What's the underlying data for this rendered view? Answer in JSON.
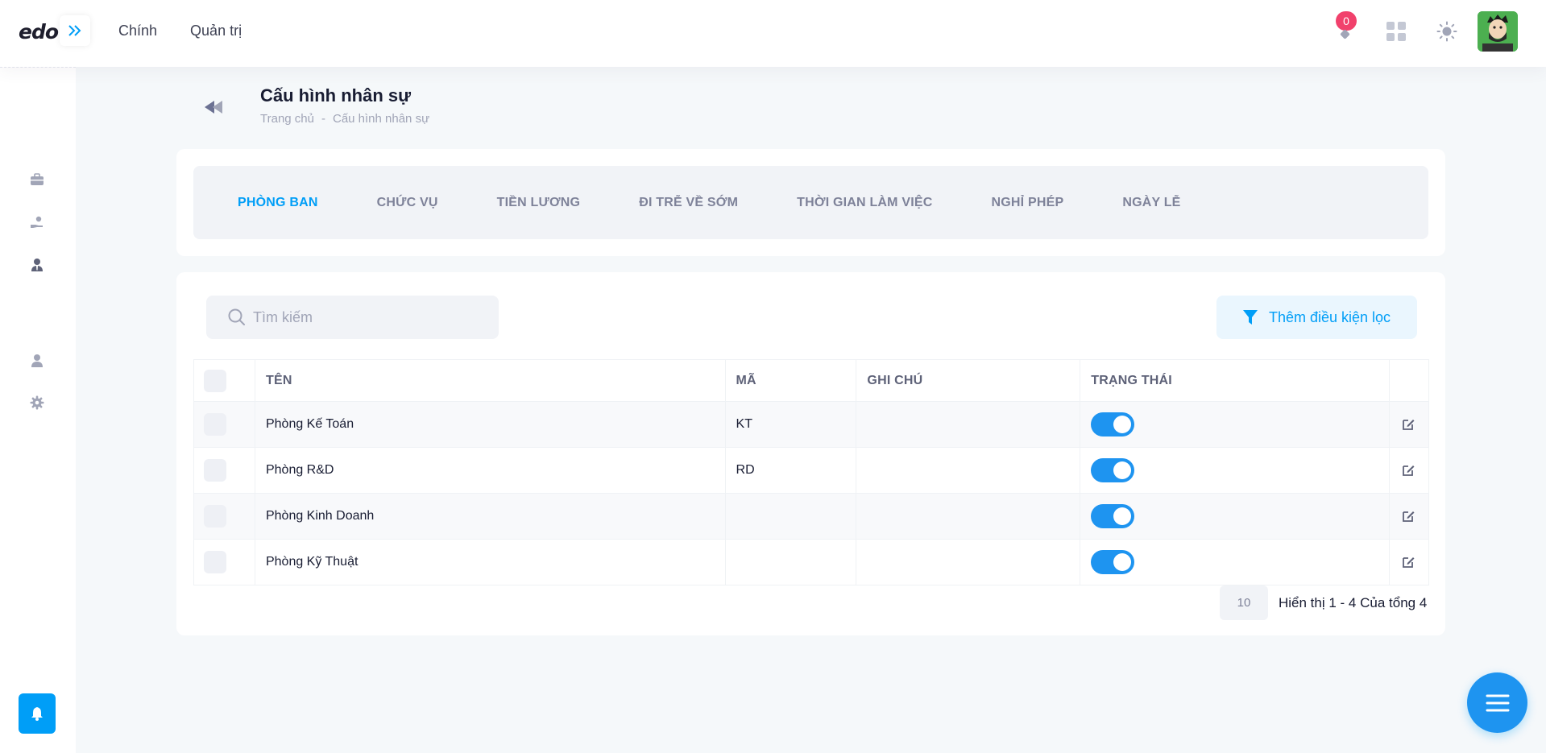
{
  "header": {
    "logo": "edo",
    "nav": [
      "Chính",
      "Quản trị"
    ],
    "notification_count": "0"
  },
  "page": {
    "title": "Cấu hình nhân sự",
    "breadcrumb": [
      "Trang chủ",
      "-",
      "Cấu hình nhân sự"
    ]
  },
  "tabs": [
    {
      "label": "PHÒNG BAN",
      "active": true
    },
    {
      "label": "CHỨC VỤ",
      "active": false
    },
    {
      "label": "TIỀN LƯƠNG",
      "active": false
    },
    {
      "label": "ĐI TRỄ VỀ SỚM",
      "active": false
    },
    {
      "label": "THỜI GIAN LÀM VIỆC",
      "active": false
    },
    {
      "label": "NGHỈ PHÉP",
      "active": false
    },
    {
      "label": "NGÀY LỄ",
      "active": false
    }
  ],
  "search": {
    "placeholder": "Tìm kiếm"
  },
  "filter_label": "Thêm điều kiện lọc",
  "table": {
    "columns": [
      "TÊN",
      "MÃ",
      "GHI CHÚ",
      "TRẠNG THÁI"
    ],
    "rows": [
      {
        "name": "Phòng Kế Toán",
        "code": "KT",
        "note": "",
        "status": true
      },
      {
        "name": "Phòng R&D",
        "code": "RD",
        "note": "",
        "status": true
      },
      {
        "name": "Phòng Kinh Doanh",
        "code": "",
        "note": "",
        "status": true
      },
      {
        "name": "Phòng Kỹ Thuật",
        "code": "",
        "note": "",
        "status": true
      }
    ]
  },
  "pagination": {
    "page_size": "10",
    "summary": "Hiển thị 1 - 4 Của tổng 4"
  },
  "colors": {
    "accent": "#009ef7",
    "badge": "#f1416c"
  }
}
